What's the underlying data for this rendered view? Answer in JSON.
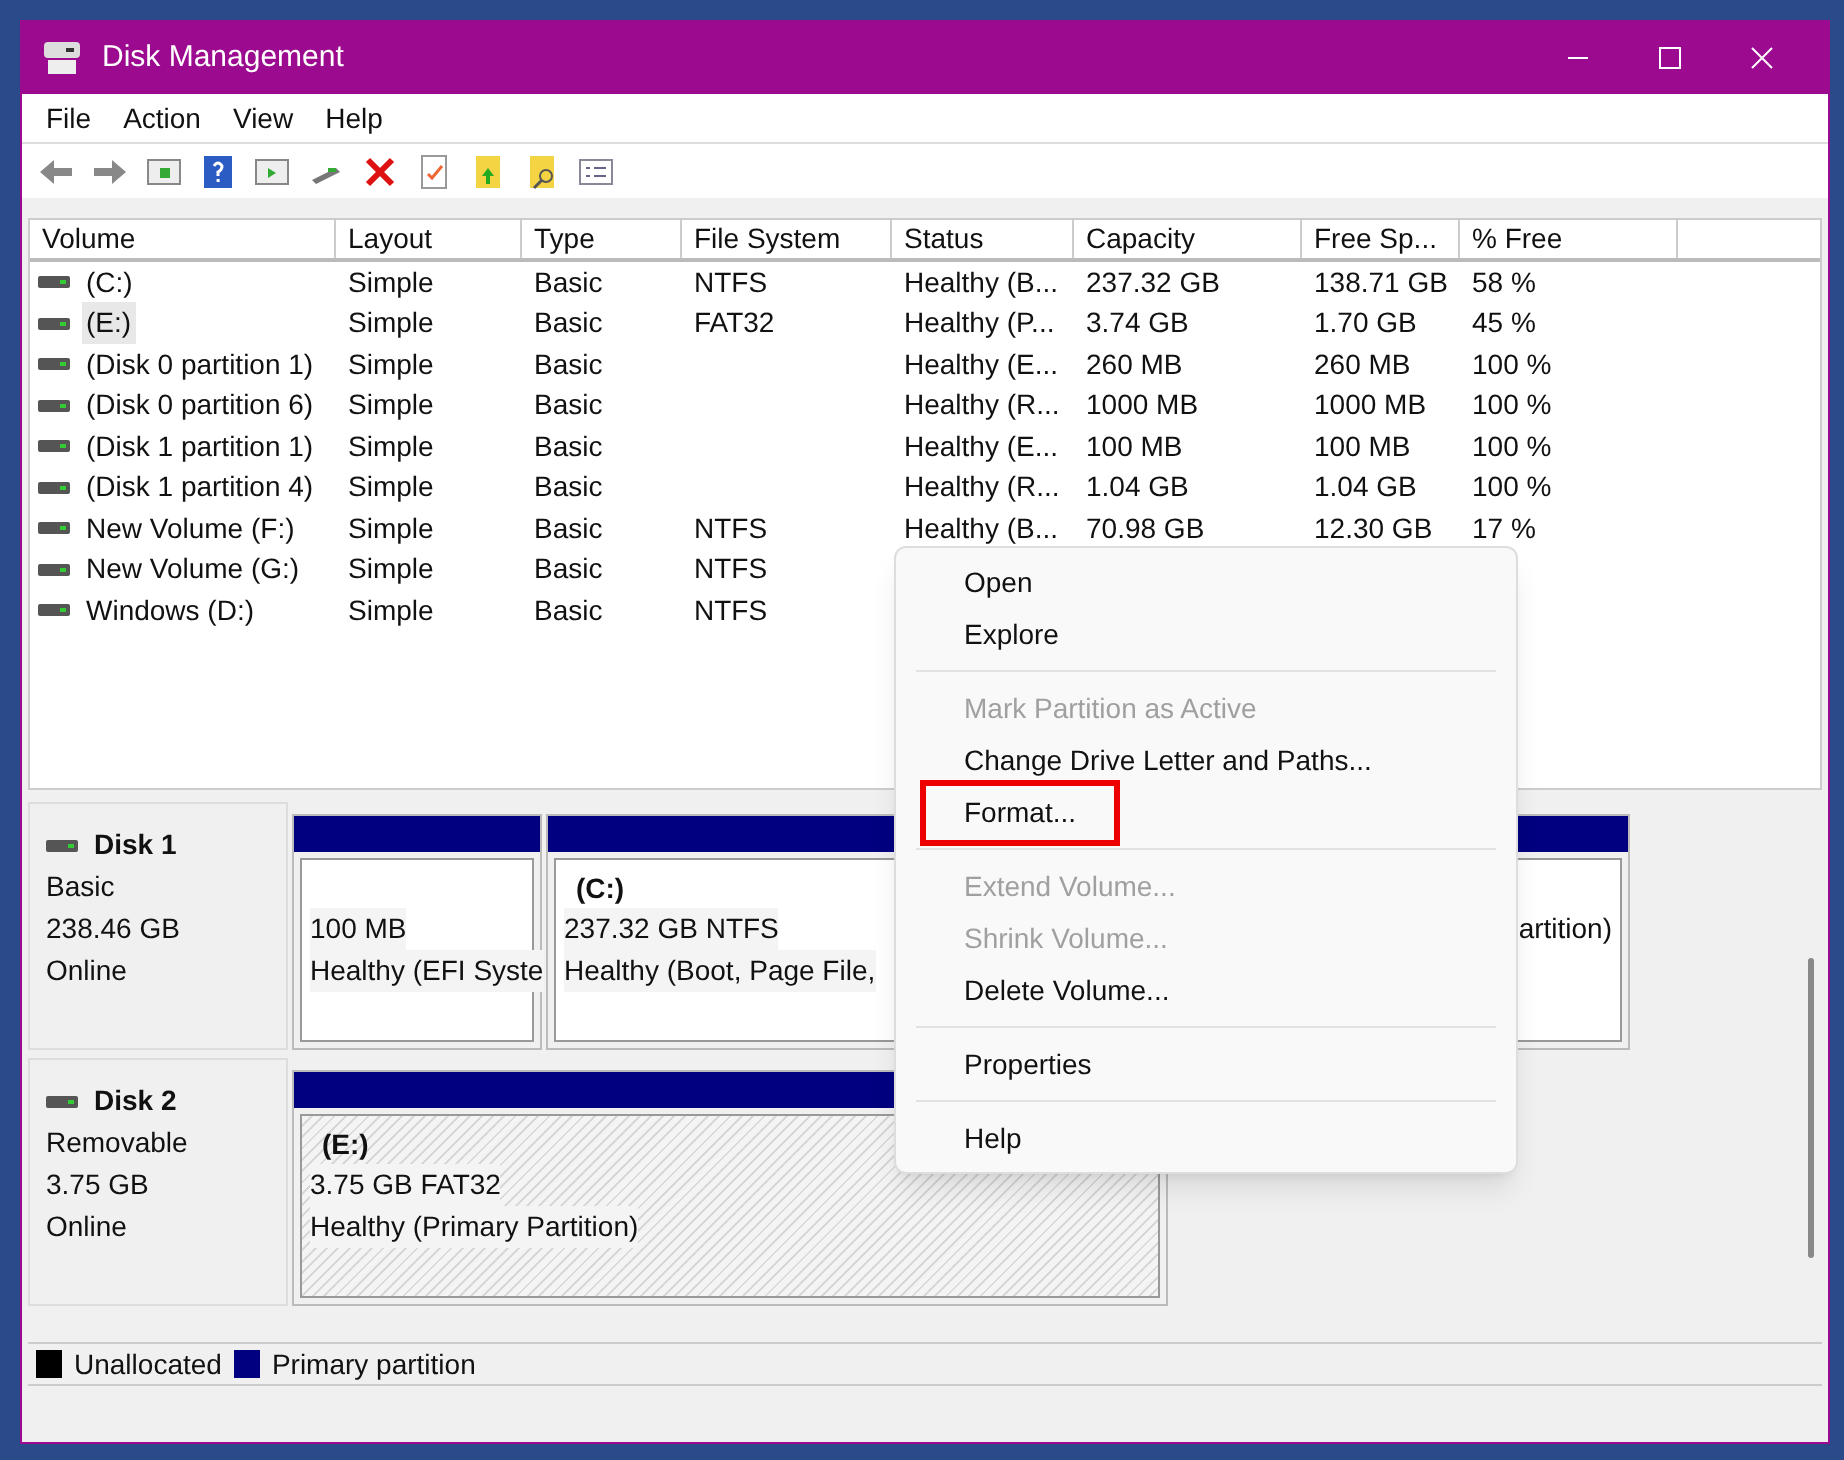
{
  "window": {
    "title": "Disk Management"
  },
  "menu_bar": [
    "File",
    "Action",
    "View",
    "Help"
  ],
  "table": {
    "columns": [
      "Volume",
      "Layout",
      "Type",
      "File System",
      "Status",
      "Capacity",
      "Free Sp...",
      "% Free"
    ],
    "rows": [
      {
        "cells": [
          "(C:)",
          "Simple",
          "Basic",
          "NTFS",
          "Healthy (B...",
          "237.32 GB",
          "138.71 GB",
          "58 %"
        ],
        "selected": false
      },
      {
        "cells": [
          "(E:)",
          "Simple",
          "Basic",
          "FAT32",
          "Healthy (P...",
          "3.74 GB",
          "1.70 GB",
          "45 %"
        ],
        "selected": true
      },
      {
        "cells": [
          "(Disk 0 partition 1)",
          "Simple",
          "Basic",
          "",
          "Healthy (E...",
          "260 MB",
          "260 MB",
          "100 %"
        ],
        "selected": false
      },
      {
        "cells": [
          "(Disk 0 partition 6)",
          "Simple",
          "Basic",
          "",
          "Healthy (R...",
          "1000 MB",
          "1000 MB",
          "100 %"
        ],
        "selected": false
      },
      {
        "cells": [
          "(Disk 1 partition 1)",
          "Simple",
          "Basic",
          "",
          "Healthy (E...",
          "100 MB",
          "100 MB",
          "100 %"
        ],
        "selected": false
      },
      {
        "cells": [
          "(Disk 1 partition 4)",
          "Simple",
          "Basic",
          "",
          "Healthy (R...",
          "1.04 GB",
          "1.04 GB",
          "100 %"
        ],
        "selected": false
      },
      {
        "cells": [
          "New Volume (F:)",
          "Simple",
          "Basic",
          "NTFS",
          "Healthy (B...",
          "70.98 GB",
          "12.30 GB",
          "17 %"
        ],
        "selected": false
      },
      {
        "cells": [
          "New Volume (G:)",
          "Simple",
          "Basic",
          "NTFS"
        ],
        "selected": false
      },
      {
        "cells": [
          "Windows (D:)",
          "Simple",
          "Basic",
          "NTFS"
        ],
        "selected": false
      }
    ]
  },
  "disks": [
    {
      "name": "Disk 1",
      "type": "Basic",
      "size": "238.46 GB",
      "state": "Online",
      "partitions": [
        {
          "size": "100 MB",
          "status": "Healthy (EFI Syste",
          "selected": false
        },
        {
          "label": "(C:)",
          "size": "237.32 GB NTFS",
          "status": "Healthy (Boot, Page File,",
          "selected": false
        },
        {
          "status": "artition)",
          "selected": false
        }
      ]
    },
    {
      "name": "Disk 2",
      "type": "Removable",
      "size": "3.75 GB",
      "state": "Online",
      "partitions": [
        {
          "label": "(E:)",
          "size": "3.75 GB FAT32",
          "status": "Healthy (Primary Partition)",
          "selected": true
        }
      ]
    }
  ],
  "legend": [
    {
      "label": "Unallocated",
      "color": "#000000"
    },
    {
      "label": "Primary partition",
      "color": "#000080"
    }
  ],
  "context_menu": [
    {
      "kind": "item",
      "label": "Open",
      "disabled": false,
      "highlighted": false
    },
    {
      "kind": "item",
      "label": "Explore",
      "disabled": false,
      "highlighted": false
    },
    {
      "kind": "separator"
    },
    {
      "kind": "item",
      "label": "Mark Partition as Active",
      "disabled": true,
      "highlighted": false
    },
    {
      "kind": "item",
      "label": "Change Drive Letter and Paths...",
      "disabled": false,
      "highlighted": false
    },
    {
      "kind": "item",
      "label": "Format...",
      "disabled": false,
      "highlighted": true
    },
    {
      "kind": "separator"
    },
    {
      "kind": "item",
      "label": "Extend Volume...",
      "disabled": true,
      "highlighted": false
    },
    {
      "kind": "item",
      "label": "Shrink Volume...",
      "disabled": true,
      "highlighted": false
    },
    {
      "kind": "item",
      "label": "Delete Volume...",
      "disabled": false,
      "highlighted": false
    },
    {
      "kind": "separator"
    },
    {
      "kind": "item",
      "label": "Properties",
      "disabled": false,
      "highlighted": false
    },
    {
      "kind": "separator"
    },
    {
      "kind": "item",
      "label": "Help",
      "disabled": false,
      "highlighted": false
    }
  ]
}
